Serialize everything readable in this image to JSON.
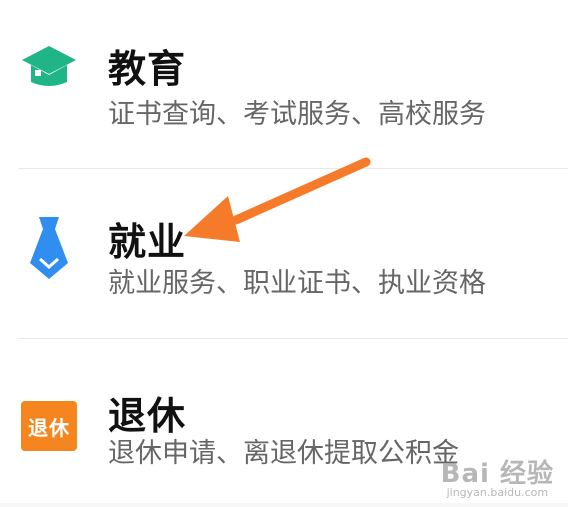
{
  "items": [
    {
      "title": "教育",
      "subtitle": "证书查询、考试服务、高校服务",
      "icon": "graduation-cap-icon",
      "icon_color": "#1fb586"
    },
    {
      "title": "就业",
      "subtitle": "就业服务、职业证书、执业资格",
      "icon": "necktie-icon",
      "icon_color": "#2f8ef0"
    },
    {
      "title": "退休",
      "subtitle": "退休申请、离退休提取公积金",
      "icon": "retire-badge-icon",
      "icon_color": "#f5861f",
      "icon_text": "退休"
    }
  ],
  "annotation": {
    "arrow_color": "#f57b2a"
  },
  "watermark": {
    "text": "Bai 经验",
    "url": "jingyan.baidu.com"
  }
}
